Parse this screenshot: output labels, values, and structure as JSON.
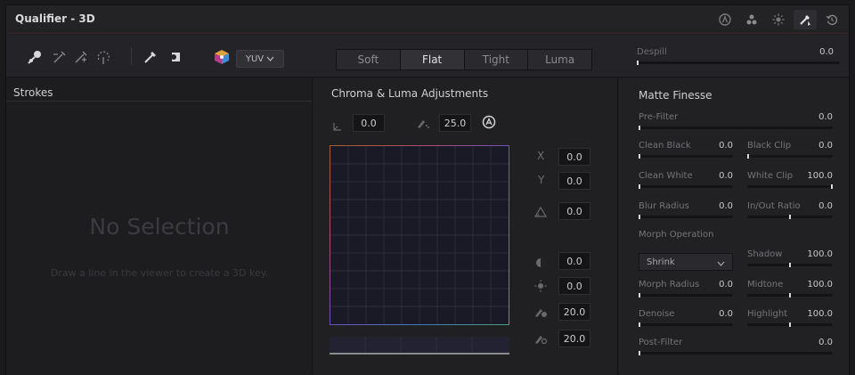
{
  "window": {
    "title": "Qualifier - 3D"
  },
  "titlebar_icons": [
    "circle-a-icon",
    "three-circles-icon",
    "sun-icon",
    "eyedropper-active-icon",
    "reset-icon"
  ],
  "toolbar": {
    "tools": [
      "eyedropper-pick-icon",
      "eyedropper-minus-icon",
      "eyedropper-plus-icon",
      "feather-icon",
      "magic-wand-icon",
      "highlight-icon",
      "color-cube-icon"
    ],
    "colorspace": "YUV",
    "modes": [
      "Soft",
      "Flat",
      "Tight",
      "Luma"
    ],
    "active_mode": "Flat",
    "despill_label": "Despill",
    "despill_value": "0.0"
  },
  "strokes": {
    "title": "Strokes",
    "empty_title": "No Selection",
    "empty_hint": "Draw a line in the viewer to create a 3D key."
  },
  "adjustments": {
    "title": "Chroma & Luma Adjustments",
    "low_value": "0.0",
    "high_value": "25.0",
    "x_label": "X",
    "x_value": "0.0",
    "y_label": "Y",
    "y_value": "0.0",
    "angle_value": "0.0",
    "sat_value": "0.0",
    "lum_value": "0.0",
    "soft1_value": "20.0",
    "soft2_value": "20.0"
  },
  "matte": {
    "title": "Matte Finesse",
    "pre_filter": {
      "label": "Pre-Filter",
      "value": "0.0",
      "level": 0
    },
    "clean_black": {
      "label": "Clean Black",
      "value": "0.0",
      "level": 0
    },
    "black_clip": {
      "label": "Black Clip",
      "value": "0.0",
      "level": 0
    },
    "clean_white": {
      "label": "Clean White",
      "value": "0.0",
      "level": 0
    },
    "white_clip": {
      "label": "White Clip",
      "value": "100.0",
      "level": 1
    },
    "blur_radius": {
      "label": "Blur Radius",
      "value": "0.0",
      "level": 0
    },
    "in_out_ratio": {
      "label": "In/Out Ratio",
      "value": "0.0",
      "level": 0.5
    },
    "morph_operation": {
      "label": "Morph Operation",
      "selected": "Shrink"
    },
    "shadow": {
      "label": "Shadow",
      "value": "100.0",
      "level": 0.5
    },
    "morph_radius": {
      "label": "Morph Radius",
      "value": "0.0",
      "level": 0
    },
    "midtone": {
      "label": "Midtone",
      "value": "100.0",
      "level": 0.5
    },
    "denoise": {
      "label": "Denoise",
      "value": "0.0",
      "level": 0
    },
    "highlight": {
      "label": "Highlight",
      "value": "100.0",
      "level": 0.5
    },
    "post_filter": {
      "label": "Post-Filter",
      "value": "0.0",
      "level": 0
    }
  }
}
